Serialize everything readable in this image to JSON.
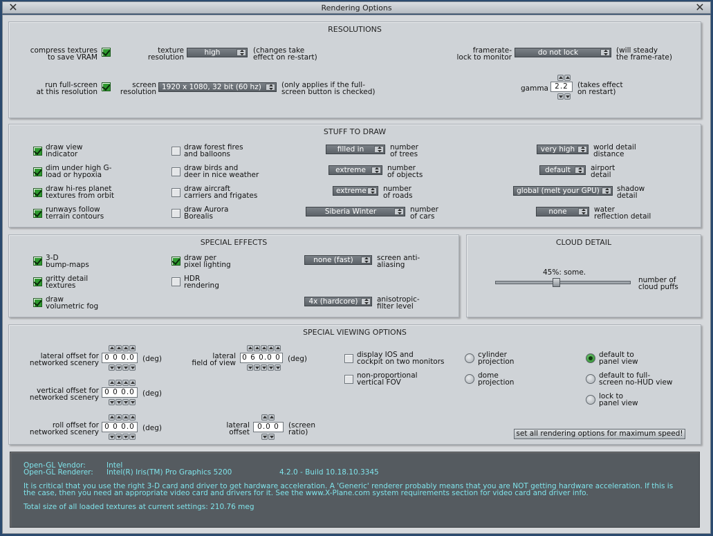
{
  "window": {
    "title": "Rendering Options",
    "close_left": "✕",
    "close_right": "✕"
  },
  "resolutions": {
    "title": "RESOLUTIONS",
    "compress_label": "compress textures\nto save VRAM",
    "compress_checked": true,
    "texres_label": "texture\nresolution",
    "texres_value": "high",
    "texres_note": "(changes take\neffect on re-start)",
    "framerate_label": "framerate-\nlock to monitor",
    "framerate_value": "do not lock",
    "framerate_note": "(will steady\nthe frame-rate)",
    "fullscreen_label": "run full-screen\nat this resolution",
    "fullscreen_checked": true,
    "screenres_label": "screen\nresolution",
    "screenres_value": "1920 x 1080, 32 bit (60 hz)",
    "screenres_note": "(only applies if the full-\nscreen button is checked)",
    "gamma_label": "gamma",
    "gamma_value": "2.2",
    "gamma_note": "(takes effect\non restart)"
  },
  "stuff": {
    "title": "STUFF TO DRAW",
    "col1": [
      {
        "label": "draw view\nindicator",
        "checked": true
      },
      {
        "label": "dim under high G-\nload or hypoxia",
        "checked": true
      },
      {
        "label": "draw hi-res planet\ntextures from orbit",
        "checked": true
      },
      {
        "label": "runways follow\nterrain contours",
        "checked": true
      }
    ],
    "col2": [
      {
        "label": "draw forest fires\nand balloons",
        "checked": false
      },
      {
        "label": "draw birds and\ndeer in nice weather",
        "checked": false
      },
      {
        "label": "draw aircraft\ncarriers and frigates",
        "checked": false
      },
      {
        "label": "draw Aurora\nBorealis",
        "checked": false
      }
    ],
    "col3": [
      {
        "value": "filled in",
        "label": "number\nof trees"
      },
      {
        "value": "extreme",
        "label": "number\nof objects"
      },
      {
        "value": "extreme",
        "label": "number\nof roads"
      },
      {
        "value": "Siberia Winter",
        "label": "number\nof cars"
      }
    ],
    "col4": [
      {
        "value": "very high",
        "label": "world detail\ndistance"
      },
      {
        "value": "default",
        "label": "airport\ndetail"
      },
      {
        "value": "global (melt your GPU)",
        "label": "shadow\ndetail"
      },
      {
        "value": "none",
        "label": "water\nreflection detail"
      }
    ]
  },
  "effects": {
    "title": "SPECIAL EFFECTS",
    "col1": [
      {
        "label": "3-D\nbump-maps",
        "checked": true
      },
      {
        "label": "gritty detail\ntextures",
        "checked": true
      },
      {
        "label": "draw\nvolumetric fog",
        "checked": true
      }
    ],
    "col2": [
      {
        "label": "draw per\npixel lighting",
        "checked": true
      },
      {
        "label": "HDR\nrendering",
        "checked": false
      }
    ],
    "aa_value": "none (fast)",
    "aa_label": "screen anti-\naliasing",
    "aniso_value": "4x (hardcore)",
    "aniso_label": "anisotropic-\nfilter level"
  },
  "clouds": {
    "title": "CLOUD DETAIL",
    "value_text": "45%: some.",
    "level": 0.45,
    "label": "number of\ncloud puffs"
  },
  "viewing": {
    "title": "SPECIAL VIEWING OPTIONS",
    "lateral_offset_label": "lateral offset for\nnetworked scenery",
    "lateral_offset_value": "0 0 0.0",
    "vertical_offset_label": "vertical offset for\nnetworked scenery",
    "vertical_offset_value": "0 0 0.0",
    "roll_offset_label": "roll offset for\nnetworked scenery",
    "roll_offset_value": "0 0 0.0",
    "deg": "(deg)",
    "lateral_fov_label": "lateral\nfield of view",
    "lateral_fov_value": "0 6 0.0 0",
    "lateral_screen_label": "lateral\noffset",
    "lateral_screen_value": "0.0 0",
    "screen_ratio": "(screen\nratio)",
    "display_ios_label": "display IOS and\ncockpit on two monitors",
    "display_ios_checked": false,
    "nonprop_label": "non-proportional\nvertical FOV",
    "nonprop_checked": false,
    "cylinder_label": "cylinder\nprojection",
    "dome_label": "dome\nprojection",
    "default_panel_label": "default to\npanel view",
    "default_full_label": "default to full-\nscreen no-HUD view",
    "lock_panel_label": "lock to\npanel view",
    "speed_button": "set all rendering options for maximum speed!"
  },
  "info": {
    "vendor_key": "Open-GL Vendor:",
    "vendor_val": "Intel",
    "renderer_key": "Open-GL Renderer:",
    "renderer_val": "Intel(R) Iris(TM) Pro Graphics 5200",
    "version": "4.2.0 - Build 10.18.10.3345",
    "warning": "It is critical that you use the right 3-D card and driver to get hardware acceleration. A 'Generic' renderer probably means that you are NOT getting hardware acceleration. If this is\nthe case, then you need an appropriate video card and drivers for it. See the www.X-Plane.com system requirements section for video card and driver info.",
    "textures": "Total size of all loaded textures at current settings: 210.76 meg"
  },
  "colors": {
    "background": "#2b4a6e",
    "panel": "#cfd3d7",
    "checkbox_on": "#2f9a2f",
    "info_text": "#7fe3ea",
    "info_bg": "#555b60"
  }
}
